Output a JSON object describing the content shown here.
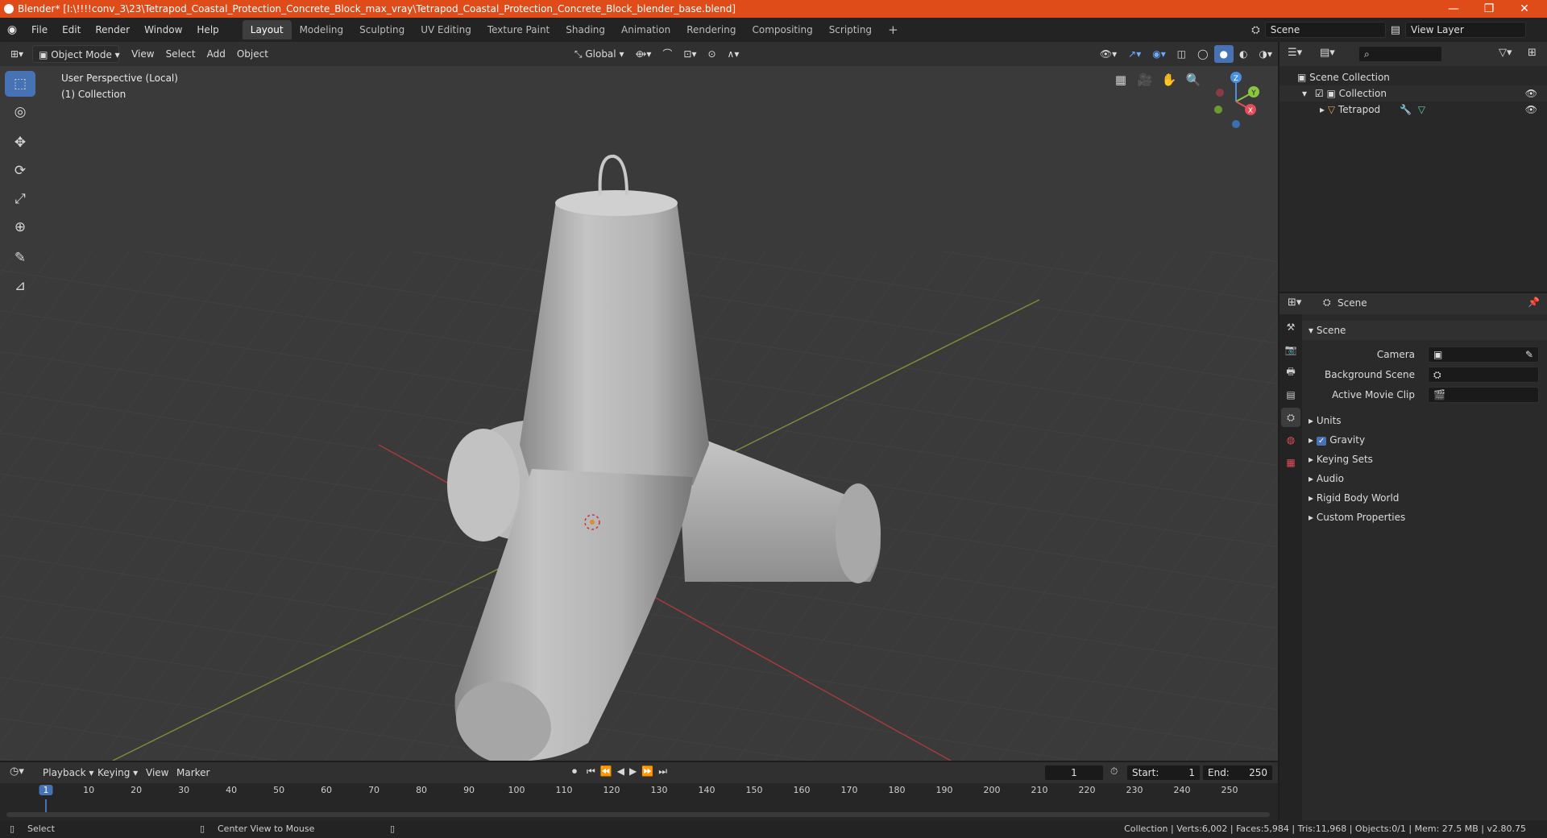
{
  "titlebar": {
    "title": "Blender* [I:\\!!!!conv_3\\23\\Tetrapod_Coastal_Protection_Concrete_Block_max_vray\\Tetrapod_Coastal_Protection_Concrete_Block_blender_base.blend]",
    "minimize": "—",
    "maximize": "❐",
    "close": "✕"
  },
  "menubar": {
    "items": [
      "File",
      "Edit",
      "Render",
      "Window",
      "Help"
    ],
    "workspaces": [
      "Layout",
      "Modeling",
      "Sculpting",
      "UV Editing",
      "Texture Paint",
      "Shading",
      "Animation",
      "Rendering",
      "Compositing",
      "Scripting"
    ],
    "add_workspace": "+",
    "scene": "Scene",
    "view_layer": "View Layer"
  },
  "viewport_header": {
    "mode": "Object Mode",
    "menus": [
      "View",
      "Select",
      "Add",
      "Object"
    ],
    "orientation": "Global"
  },
  "viewport": {
    "perspective": "User Perspective (Local)",
    "collection": "(1) Collection",
    "gizmo": {
      "z": "Z",
      "y": "Y",
      "x": "X"
    }
  },
  "toolbar": {
    "tools": [
      {
        "icon": "select-box-icon",
        "glyph": "⬚",
        "active": true
      },
      {
        "icon": "cursor-icon",
        "glyph": "◎",
        "active": false
      },
      {
        "icon": "move-icon",
        "glyph": "✥",
        "active": false
      },
      {
        "icon": "rotate-icon",
        "glyph": "⟳",
        "active": false
      },
      {
        "icon": "scale-icon",
        "glyph": "⤢",
        "active": false
      },
      {
        "icon": "transform-icon",
        "glyph": "⊕",
        "active": false
      },
      {
        "icon": "annotate-icon",
        "glyph": "✎",
        "active": false
      },
      {
        "icon": "measure-icon",
        "glyph": "📐",
        "active": false
      }
    ]
  },
  "outliner": {
    "root": "Scene Collection",
    "collection": "Collection",
    "object": "Tetrapod"
  },
  "properties": {
    "header": "Scene",
    "panel_title": "Scene",
    "camera_label": "Camera",
    "background_scene_label": "Background Scene",
    "active_movie_clip_label": "Active Movie Clip",
    "sections": [
      "Units",
      "Gravity",
      "Keying Sets",
      "Audio",
      "Rigid Body World",
      "Custom Properties"
    ]
  },
  "timeline": {
    "menus": [
      "Playback",
      "Keying",
      "View",
      "Marker"
    ],
    "current_frame": "1",
    "start_label": "Start:",
    "start": "1",
    "end_label": "End:",
    "end": "250",
    "ticks": [
      "1",
      "10",
      "20",
      "30",
      "40",
      "50",
      "60",
      "70",
      "80",
      "90",
      "100",
      "110",
      "120",
      "130",
      "140",
      "150",
      "160",
      "170",
      "180",
      "190",
      "200",
      "210",
      "220",
      "230",
      "240",
      "250"
    ]
  },
  "statusbar": {
    "select": "Select",
    "center_view": "Center View to Mouse",
    "stats": "Collection | Verts:6,002 | Faces:5,984 | Tris:11,968 | Objects:0/1 | Mem: 27.5 MB | v2.80.75"
  },
  "colors": {
    "titlebar": "#e04b1a",
    "active_tool": "#4772b3",
    "x_axis": "#e44d5a",
    "y_axis": "#8cc63e",
    "z_axis": "#4a8fe0"
  }
}
